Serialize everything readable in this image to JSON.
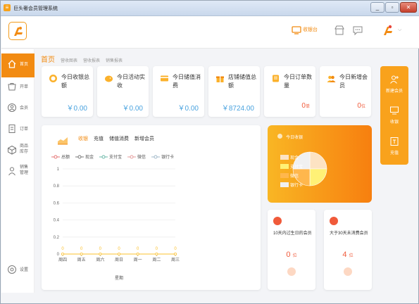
{
  "window": {
    "title": "巨头奢会员管理系统",
    "min": "_",
    "max": "▫",
    "close": "✕"
  },
  "topbar": {
    "cashier_label": "收银台"
  },
  "sidebar": {
    "items": [
      {
        "label": "首页",
        "icon": "home-icon",
        "active": true
      },
      {
        "label": "开单",
        "icon": "cart-icon"
      },
      {
        "label": "会员",
        "icon": "user-icon"
      },
      {
        "label": "订单",
        "icon": "document-icon"
      },
      {
        "label": "商品\n库存",
        "icon": "box-icon"
      },
      {
        "label": "销售\n管理",
        "icon": "person-icon"
      }
    ],
    "settings_label": "设置"
  },
  "tabs": {
    "main": "首页",
    "subs": [
      "营收图表",
      "营收报表",
      "销售报表"
    ]
  },
  "stats": [
    {
      "title": "今日收银总额",
      "value": "￥0.00",
      "icon": "coin-icon"
    },
    {
      "title": "今日活动实收",
      "value": "￥0.00",
      "icon": "piggy-bank-icon"
    },
    {
      "title": "今日储值消费",
      "value": "￥0.00",
      "icon": "card-icon"
    },
    {
      "title": "店铺储值总额",
      "value": "￥8724.00",
      "icon": "gift-icon"
    },
    {
      "title": "今日订单数量",
      "value": "0",
      "unit": "单",
      "icon": "order-icon"
    },
    {
      "title": "今日新增会员",
      "value": "0",
      "unit": "位",
      "icon": "members-icon"
    }
  ],
  "quick_actions": [
    {
      "label": "新建会员",
      "icon": "add-user-icon"
    },
    {
      "label": "收银",
      "icon": "monitor-icon"
    },
    {
      "label": "充值",
      "icon": "recharge-icon"
    }
  ],
  "chart_panel": {
    "tabs": [
      "收银",
      "充值",
      "储值消费",
      "新增会员"
    ],
    "active_tab": "收银",
    "legend": [
      {
        "name": "总额",
        "color": "#e57373"
      },
      {
        "name": "现金",
        "color": "#777777"
      },
      {
        "name": "支付宝",
        "color": "#6bb8a8"
      },
      {
        "name": "微信",
        "color": "#e59c9c"
      },
      {
        "name": "银行卡",
        "color": "#a0b8c8"
      }
    ]
  },
  "chart_data": {
    "type": "line",
    "categories": [
      "周四",
      "周五",
      "周六",
      "周日",
      "周一",
      "周二",
      "周三"
    ],
    "series": [
      {
        "name": "总额",
        "values": [
          0,
          0,
          0,
          0,
          0,
          0,
          0
        ]
      }
    ],
    "yticks": [
      "0",
      "0.2",
      "0.4",
      "0.6",
      "0.8",
      "1"
    ],
    "ylim": [
      0,
      1
    ],
    "xlabel": "星期",
    "point_labels": [
      "0",
      "0",
      "0",
      "0",
      "0",
      "0",
      "0"
    ]
  },
  "pie_card": {
    "title": "今日收银",
    "legend": [
      "现金",
      "支付宝",
      "微信",
      "银行卡"
    ],
    "colors": [
      "#fde3c3",
      "#fff176",
      "#ffb74d",
      "#f0f0f0"
    ]
  },
  "mini_cards": [
    {
      "text": "10天内过生日的会员",
      "value": "0",
      "unit": "位",
      "icon": "cake-icon"
    },
    {
      "text": "大于30天未消费会员",
      "value": "4",
      "unit": "位",
      "icon": "crown-icon"
    }
  ]
}
